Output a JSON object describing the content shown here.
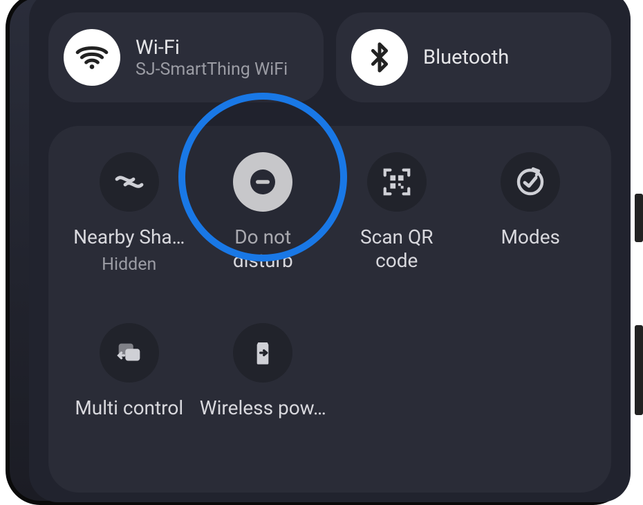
{
  "pills": {
    "wifi": {
      "title": "Wi-Fi",
      "subtitle": "SJ-SmartThing WiFi"
    },
    "bluetooth": {
      "title": "Bluetooth"
    }
  },
  "tiles": {
    "nearby_share": {
      "label": "Nearby Sha…",
      "sub": "Hidden"
    },
    "dnd": {
      "label": "Do not\ndisturb"
    },
    "qr": {
      "label": "Scan QR\ncode"
    },
    "modes": {
      "label": "Modes"
    },
    "multi_control": {
      "label": "Multi control"
    },
    "wireless_power": {
      "label": "Wireless pow…"
    }
  }
}
